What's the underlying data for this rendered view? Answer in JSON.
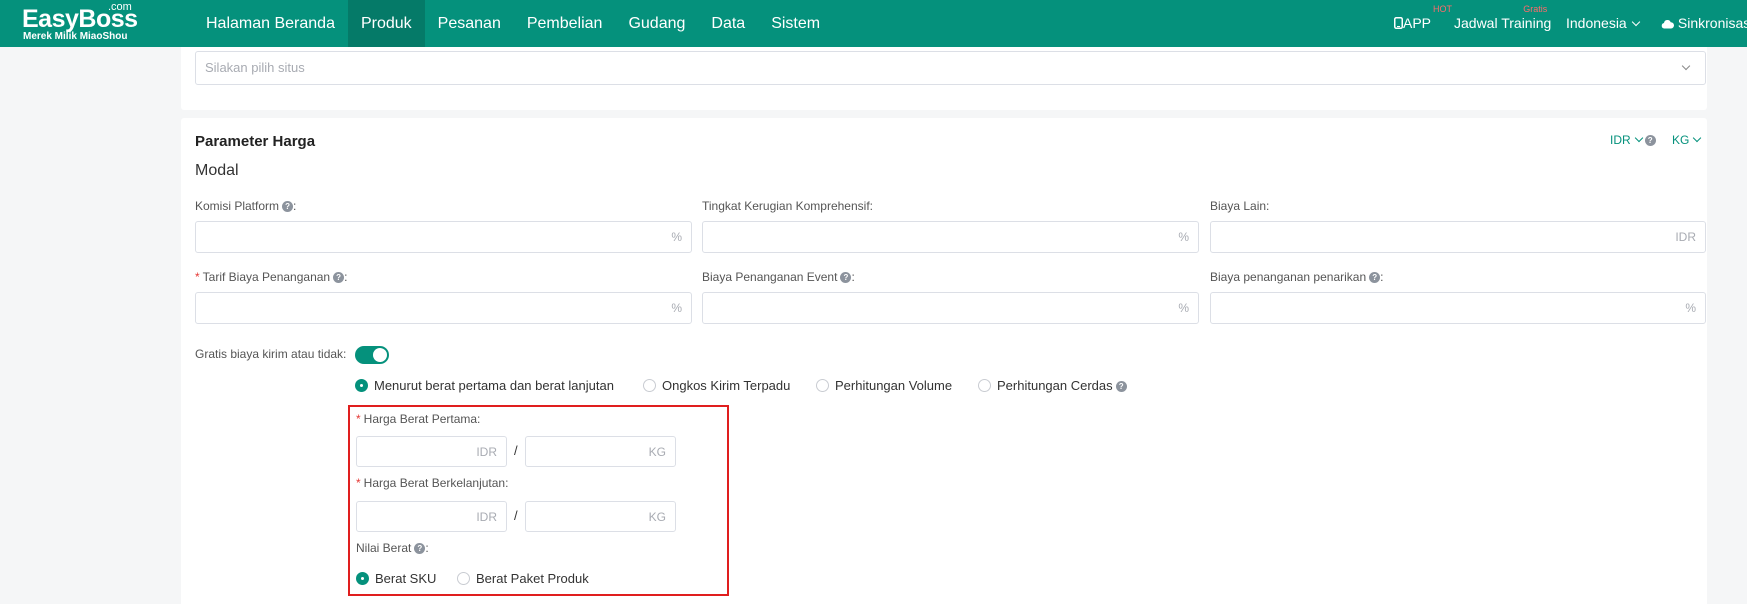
{
  "brand": {
    "name": "EasyBoss",
    "suffix": ".com",
    "tagline": "Merek Milik MiaoShou"
  },
  "nav": {
    "items": [
      "Halaman Beranda",
      "Produk",
      "Pesanan",
      "Pembelian",
      "Gudang",
      "Data",
      "Sistem"
    ],
    "active_index": 1
  },
  "topbar": {
    "app_label": "APP",
    "app_badge": "HOT",
    "training_label": "Jadwal Training",
    "training_badge": "Gratis",
    "language": "Indonesia",
    "sync_label": "Sinkronisasi"
  },
  "site_select": {
    "placeholder": "Silakan pilih situs"
  },
  "pricing": {
    "title": "Parameter Harga",
    "currency": "IDR",
    "weight_unit": "KG",
    "subtitle": "Modal",
    "fields": {
      "platform_commission": {
        "label": "Komisi Platform",
        "suffix": "%"
      },
      "loss_rate": {
        "label": "Tingkat Kerugian Komprehensif:",
        "suffix": "%"
      },
      "other_cost": {
        "label": "Biaya Lain:",
        "suffix": "IDR"
      },
      "handling_fee": {
        "label": "Tarif Biaya Penanganan",
        "suffix": "%"
      },
      "event_fee": {
        "label": "Biaya Penanganan Event",
        "suffix": "%"
      },
      "withdraw_fee": {
        "label": "Biaya penanganan penarikan",
        "suffix": "%"
      }
    },
    "free_shipping": {
      "label": "Gratis biaya kirim atau tidak:",
      "enabled": true
    },
    "shipping_methods": {
      "options": [
        "Menurut berat pertama dan berat lanjutan",
        "Ongkos Kirim Terpadu",
        "Perhitungan Volume",
        "Perhitungan Cerdas"
      ],
      "selected_index": 0
    },
    "first_weight": {
      "label": "Harga Berat Pertama:",
      "price_suffix": "IDR",
      "weight_suffix": "KG",
      "separator": "/"
    },
    "continued_weight": {
      "label": "Harga Berat Berkelanjutan:",
      "price_suffix": "IDR",
      "weight_suffix": "KG",
      "separator": "/"
    },
    "weight_value": {
      "label": "Nilai Berat",
      "options": [
        "Berat SKU",
        "Berat Paket Produk"
      ],
      "selected_index": 0
    }
  },
  "colors": {
    "brand": "#05917c",
    "brand_active": "#057a68",
    "highlight": "#e01e1e",
    "required": "#e53935"
  }
}
